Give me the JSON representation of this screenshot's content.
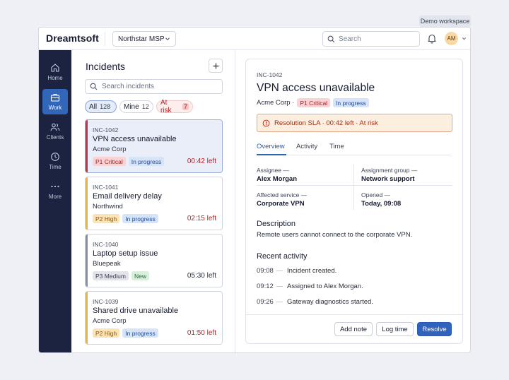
{
  "workspace_badge": "Demo workspace",
  "app": {
    "logo": "Dreamtsoft",
    "org": "Northstar MSP",
    "search_placeholder": "Search",
    "avatar_initials": "AM"
  },
  "nav": {
    "items": [
      {
        "label": "Home",
        "icon": "home-icon"
      },
      {
        "label": "Work",
        "icon": "briefcase-icon",
        "active": true
      },
      {
        "label": "Clients",
        "icon": "users-icon"
      },
      {
        "label": "Time",
        "icon": "clock-icon"
      },
      {
        "label": "More",
        "icon": "more-icon"
      }
    ]
  },
  "list": {
    "title": "Incidents",
    "search_placeholder": "Search incidents",
    "filters": [
      {
        "label": "All",
        "count": "128",
        "active": true
      },
      {
        "label": "Mine",
        "count": "12"
      },
      {
        "label": "At risk",
        "count": "7"
      }
    ],
    "cards": [
      {
        "id": "INC-1042",
        "title": "VPN access unavailable",
        "client": "Acme Corp",
        "priority": "P1 Critical",
        "status": "In progress",
        "time": "00:42 left",
        "selected": true
      },
      {
        "id": "INC-1041",
        "title": "Email delivery delay",
        "client": "Northwind",
        "priority": "P2 High",
        "status": "In progress",
        "time": "02:15 left"
      },
      {
        "id": "INC-1040",
        "title": "Laptop setup issue",
        "client": "Bluepeak",
        "priority": "P3 Medium",
        "status": "New",
        "time": "05:30 left"
      },
      {
        "id": "INC-1039",
        "title": "Shared drive unavailable",
        "client": "Acme Corp",
        "priority": "P2 High",
        "status": "In progress",
        "time": "01:50 left"
      }
    ]
  },
  "detail": {
    "id": "INC-1042",
    "title": "VPN access unavailable",
    "client": "Acme Corp ·",
    "priority": "P1 Critical",
    "status": "In progress",
    "sla": "Resolution SLA · 00:42 left · At risk",
    "tabs": [
      "Overview",
      "Activity",
      "Time"
    ],
    "fields": {
      "assignee_label": "Assignee —",
      "assignee": "Alex Morgan",
      "group_label": "Assignment group —",
      "group": "Network support",
      "service_label": "Affected service —",
      "service": "Corporate VPN",
      "opened_label": "Opened —",
      "opened": "Today, 09:08"
    },
    "description_title": "Description",
    "description": "Remote users cannot connect to the corporate VPN.",
    "activity_title": "Recent activity",
    "activity": [
      {
        "time": "09:08",
        "text": "Incident created."
      },
      {
        "time": "09:12",
        "text": "Assigned to Alex Morgan."
      },
      {
        "time": "09:26",
        "text": "Gateway diagnostics started."
      }
    ],
    "buttons": {
      "add_note": "Add note",
      "log_time": "Log time",
      "resolve": "Resolve"
    }
  },
  "colors": {
    "nav_bg": "#1b2340",
    "accent": "#2f63c0",
    "p1": "#d93a3a",
    "p2": "#f0b43c",
    "p3": "#8a90a0",
    "danger_text": "#b42323",
    "neutral_text": "#2a2f40"
  }
}
